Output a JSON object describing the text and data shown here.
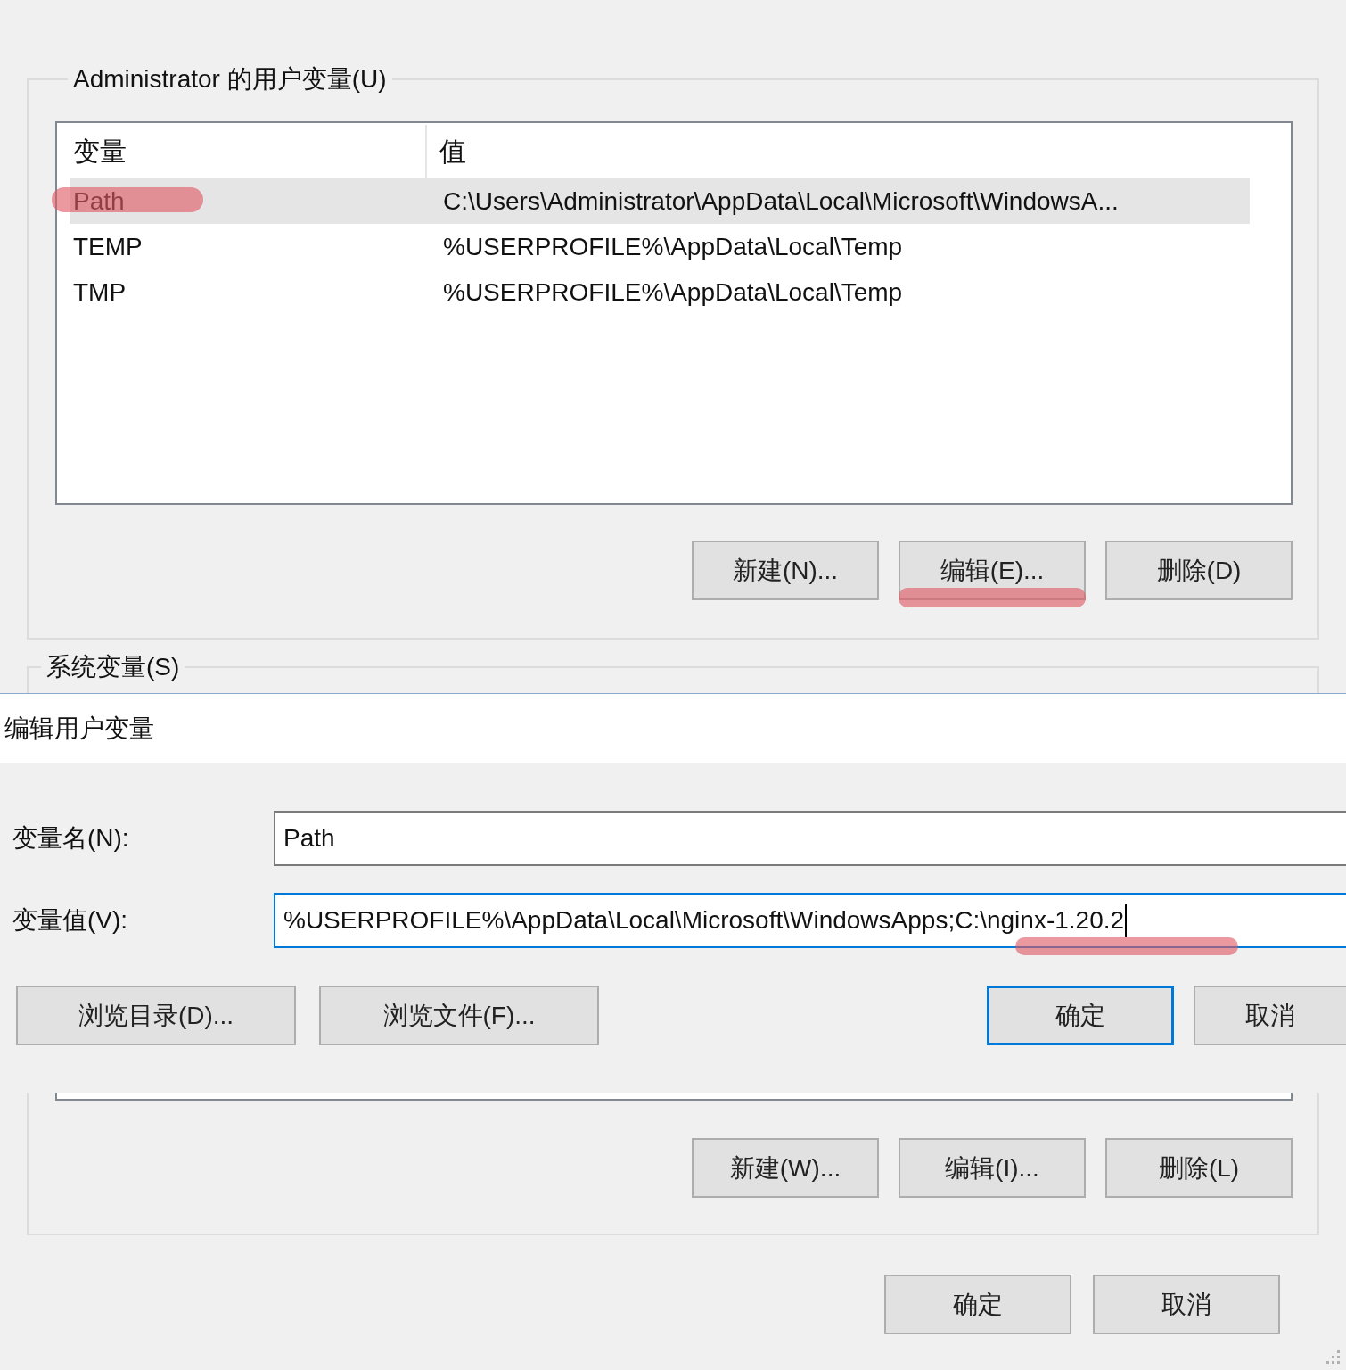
{
  "user_variables": {
    "title": "Administrator 的用户变量(U)",
    "columns": [
      "变量",
      "值"
    ],
    "rows": [
      {
        "name": "Path",
        "value": "C:\\Users\\Administrator\\AppData\\Local\\Microsoft\\WindowsA...",
        "selected": true,
        "marked": true
      },
      {
        "name": "TEMP",
        "value": "%USERPROFILE%\\AppData\\Local\\Temp",
        "selected": false,
        "marked": false
      },
      {
        "name": "TMP",
        "value": "%USERPROFILE%\\AppData\\Local\\Temp",
        "selected": false,
        "marked": false
      }
    ],
    "buttons": [
      {
        "label": "新建(N)...",
        "marked": false
      },
      {
        "label": "编辑(E)...",
        "marked": true
      },
      {
        "label": "删除(D)",
        "marked": false
      }
    ]
  },
  "system_variables": {
    "title": "系统变量(S)",
    "buttons": [
      {
        "label": "新建(W)..."
      },
      {
        "label": "编辑(I)..."
      },
      {
        "label": "删除(L)"
      }
    ]
  },
  "edit_dialog": {
    "title": "编辑用户变量",
    "fields": [
      {
        "label": "变量名(N):",
        "value": "Path",
        "focused": false,
        "marked": false
      },
      {
        "label": "变量值(V):",
        "value": "%USERPROFILE%\\AppData\\Local\\Microsoft\\WindowsApps;C:\\nginx-1.20.2",
        "focused": true,
        "marked": true
      }
    ],
    "buttons": [
      {
        "label": "浏览目录(D)...",
        "default": false
      },
      {
        "label": "浏览文件(F)...",
        "default": false
      },
      {
        "label": "确定",
        "default": true
      },
      {
        "label": "取消",
        "default": false
      }
    ]
  },
  "footer_buttons": [
    "确定",
    "取消"
  ]
}
